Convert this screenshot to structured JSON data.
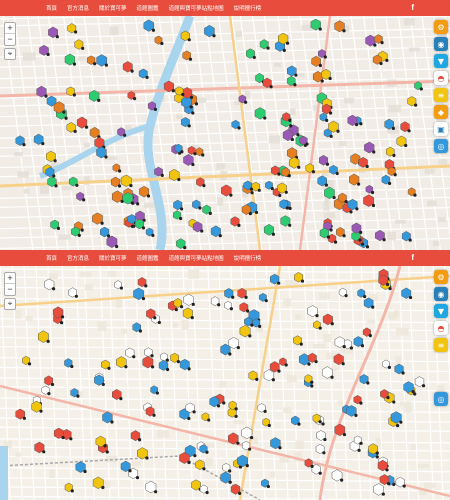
{
  "nav": {
    "items": [
      "首頁",
      "官方消息",
      "關於寶可夢",
      "道館圖鑑",
      "道館與寶可夢站點地圖",
      "說明擅行榜"
    ],
    "facebook_icon": "f"
  },
  "colors": {
    "navbar": "#e74c3c",
    "map_top_bg": "#f1ede6",
    "map_bottom_bg": "#f4f0e8",
    "water": "#a8d4ee"
  },
  "map_controls": {
    "zoom_in": "+",
    "zoom_out": "−"
  },
  "toolbar_icons": [
    "settings-icon",
    "eye-icon",
    "filter-icon",
    "pokeball-icon",
    "layers-icon",
    "gym-icon",
    "pokestop-icon",
    "locate-icon"
  ]
}
